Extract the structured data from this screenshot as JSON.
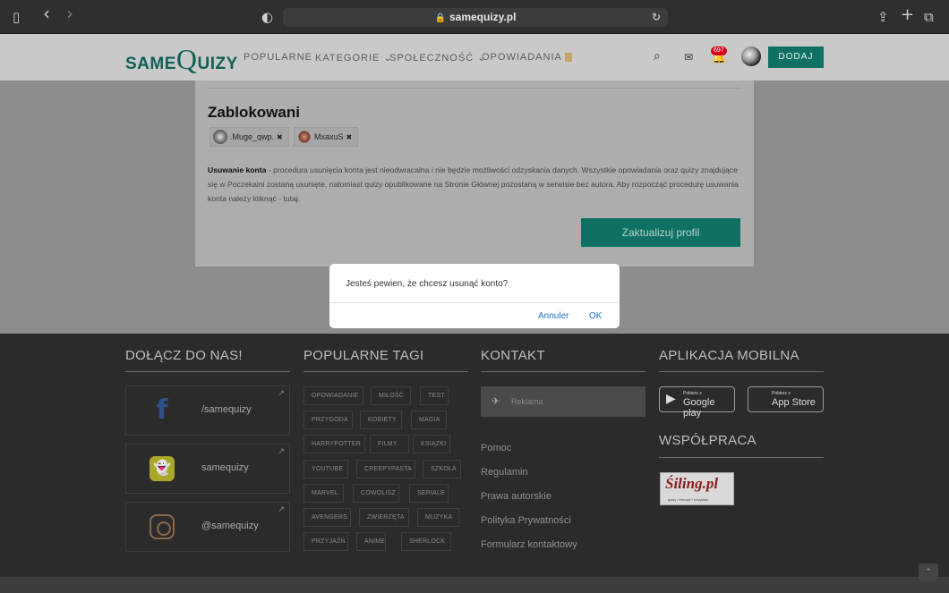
{
  "browser": {
    "url": "samequizy.pl",
    "sidebar_icon": "▯",
    "back_icon": "‹",
    "forward_icon": "›",
    "shield_icon": "◐",
    "lock_icon": "🔒",
    "reload_icon": "↻",
    "share_icon": "⇪",
    "newtab_icon": "+",
    "tabs_icon": "⧉"
  },
  "nav": {
    "logo_same": "SAME",
    "logo_q": "Q",
    "logo_uizy": "UIZY",
    "items": [
      "POPULARNE",
      "KATEGORIE ⌄",
      "SPOŁECZNOŚĆ ⌄",
      "OPOWIADANIA"
    ],
    "notification_count": "697",
    "add_label": "DODAJ"
  },
  "profile": {
    "blocked_title": "Zablokowani",
    "blocked_users": [
      ".Muge_qwp.",
      "MxaxuS"
    ],
    "delete_bold": "Usuwanie konta",
    "delete_text": " - procedura usunięcia konta jest nieodwracalna i nie będzie możliwości odzyskania danych. Wszystkie opowiadania oraz quizy znajdujące się w Poczekalni zostaną usunięte, natomiast quizy opublikowane na Stronie Głównej pozostaną w serwisie bez autora. Aby rozpocząć procedurę usuwania konta należy kliknąć - tutaj.",
    "update_button": "Zaktualizuj profil"
  },
  "dialog": {
    "message": "Jesteś pewien, że chcesz usunąć konto?",
    "cancel": "Annuler",
    "ok": "OK"
  },
  "footer": {
    "join_title": "DOŁĄCZ DO NAS!",
    "social": [
      "/samequizy",
      "samequizy",
      "@samequizy"
    ],
    "tags_title": "POPULARNE TAGI",
    "tags": [
      [
        "OPOWIADANIE",
        "MIŁOŚĆ",
        "TEST"
      ],
      [
        "PRZYGODA",
        "KOBIETY",
        "MAGIA"
      ],
      [
        "HARRYPOTTER",
        "FILMY",
        "KSIĄŻKI"
      ],
      [
        "YOUTUBE",
        "CREEPYPASTA",
        "SZKOŁA"
      ],
      [
        "MARVEL",
        "COWOLISZ",
        "SERIALE"
      ],
      [
        "AVENGERS",
        "ZWIERZĘTA",
        "MUZYKA"
      ],
      [
        "PRZYJAŹŃ",
        "ANIME",
        "SHERLOCK"
      ]
    ],
    "contact_title": "KONTAKT",
    "reklama": "Reklama",
    "links": [
      "Pomoc",
      "Regulamin",
      "Prawa autorskie",
      "Polityka Prywatności",
      "Formularz kontaktowy"
    ],
    "app_title": "APLIKACJA MOBILNA",
    "google_small": "Pobierz z",
    "google_big": "Google play",
    "apple_small": "Pobierz z",
    "apple_big": "App Store",
    "coop_title": "WSPÓŁPRACA",
    "partner_logo": "Śiling.pl",
    "partner_sub": "quizy / emocje / rozrywka"
  }
}
